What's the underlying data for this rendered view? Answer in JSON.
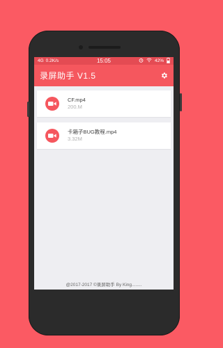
{
  "statusbar": {
    "network": "4G",
    "speed": "0.2K/s",
    "time": "15:05",
    "battery": "42%",
    "icons": [
      "alarm-icon",
      "wifi-icon",
      "battery-icon"
    ]
  },
  "appbar": {
    "title": "录屏助手 V1.5",
    "settings_icon": "gear-icon"
  },
  "files": [
    {
      "name": "CF.mp4",
      "size": "200.M"
    },
    {
      "name": "卡箱子BUG教程.mp4",
      "size": "3.32M"
    }
  ],
  "footer": {
    "text": "@2017-2017 ©录屏助手 By King........"
  },
  "colors": {
    "background": "#FB5A63",
    "appbar": "#F5575E",
    "statusbar": "#E44B53",
    "screen": "#EEEEF2"
  }
}
